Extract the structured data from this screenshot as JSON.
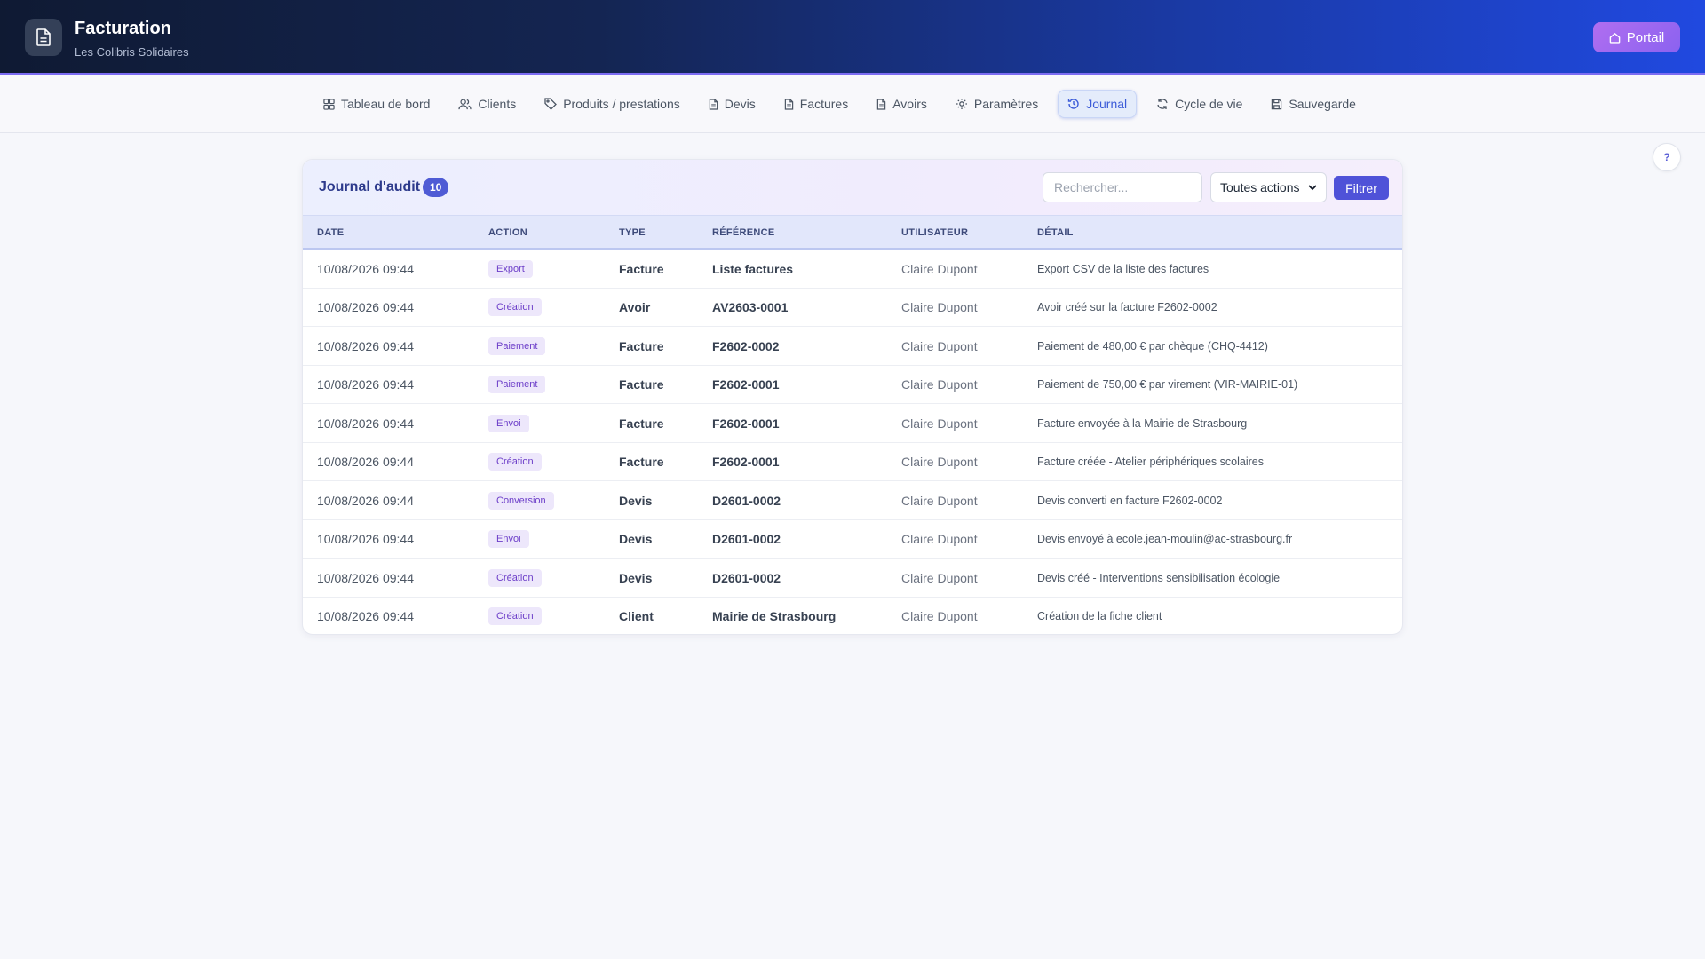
{
  "app": {
    "title": "Facturation",
    "subtitle": "Les Colibris Solidaires",
    "portal_label": "Portail"
  },
  "nav": [
    {
      "label": "Tableau de bord",
      "icon": "grid-icon"
    },
    {
      "label": "Clients",
      "icon": "users-icon"
    },
    {
      "label": "Produits / prestations",
      "icon": "tag-icon"
    },
    {
      "label": "Devis",
      "icon": "document-icon"
    },
    {
      "label": "Factures",
      "icon": "document-icon"
    },
    {
      "label": "Avoirs",
      "icon": "document-icon"
    },
    {
      "label": "Paramètres",
      "icon": "gear-icon"
    },
    {
      "label": "Journal",
      "icon": "history-icon",
      "active": true
    },
    {
      "label": "Cycle de vie",
      "icon": "refresh-icon"
    },
    {
      "label": "Sauvegarde",
      "icon": "save-icon"
    }
  ],
  "help_label": "?",
  "journal": {
    "title": "Journal d'audit",
    "count": "10",
    "search_placeholder": "Rechercher...",
    "action_filter": "Toutes actions",
    "filter_label": "Filtrer",
    "columns": [
      "DATE",
      "ACTION",
      "TYPE",
      "RÉFÉRENCE",
      "UTILISATEUR",
      "DÉTAIL"
    ],
    "rows": [
      {
        "date": "10/08/2026 09:44",
        "action": "Export",
        "type": "Facture",
        "reference": "Liste factures",
        "user": "Claire Dupont",
        "detail": "Export CSV de la liste des factures"
      },
      {
        "date": "10/08/2026 09:44",
        "action": "Création",
        "type": "Avoir",
        "reference": "AV2603-0001",
        "user": "Claire Dupont",
        "detail": "Avoir créé sur la facture F2602-0002"
      },
      {
        "date": "10/08/2026 09:44",
        "action": "Paiement",
        "type": "Facture",
        "reference": "F2602-0002",
        "user": "Claire Dupont",
        "detail": "Paiement de 480,00 € par chèque (CHQ-4412)"
      },
      {
        "date": "10/08/2026 09:44",
        "action": "Paiement",
        "type": "Facture",
        "reference": "F2602-0001",
        "user": "Claire Dupont",
        "detail": "Paiement de 750,00 € par virement (VIR-MAIRIE-01)"
      },
      {
        "date": "10/08/2026 09:44",
        "action": "Envoi",
        "type": "Facture",
        "reference": "F2602-0001",
        "user": "Claire Dupont",
        "detail": "Facture envoyée à la Mairie de Strasbourg"
      },
      {
        "date": "10/08/2026 09:44",
        "action": "Création",
        "type": "Facture",
        "reference": "F2602-0001",
        "user": "Claire Dupont",
        "detail": "Facture créée - Atelier périphériques scolaires"
      },
      {
        "date": "10/08/2026 09:44",
        "action": "Conversion",
        "type": "Devis",
        "reference": "D2601-0002",
        "user": "Claire Dupont",
        "detail": "Devis converti en facture F2602-0002"
      },
      {
        "date": "10/08/2026 09:44",
        "action": "Envoi",
        "type": "Devis",
        "reference": "D2601-0002",
        "user": "Claire Dupont",
        "detail": "Devis envoyé à ecole.jean-moulin@ac-strasbourg.fr"
      },
      {
        "date": "10/08/2026 09:44",
        "action": "Création",
        "type": "Devis",
        "reference": "D2601-0002",
        "user": "Claire Dupont",
        "detail": "Devis créé - Interventions sensibilisation écologie"
      },
      {
        "date": "10/08/2026 09:44",
        "action": "Création",
        "type": "Client",
        "reference": "Mairie de Strasbourg",
        "user": "Claire Dupont",
        "detail": "Création de la fiche client"
      }
    ]
  },
  "colors": {
    "accent": "#4f52d8",
    "active_nav": "#3b5bd8",
    "badge_bg": "#ede7fb",
    "badge_text": "#6d3fc9"
  }
}
